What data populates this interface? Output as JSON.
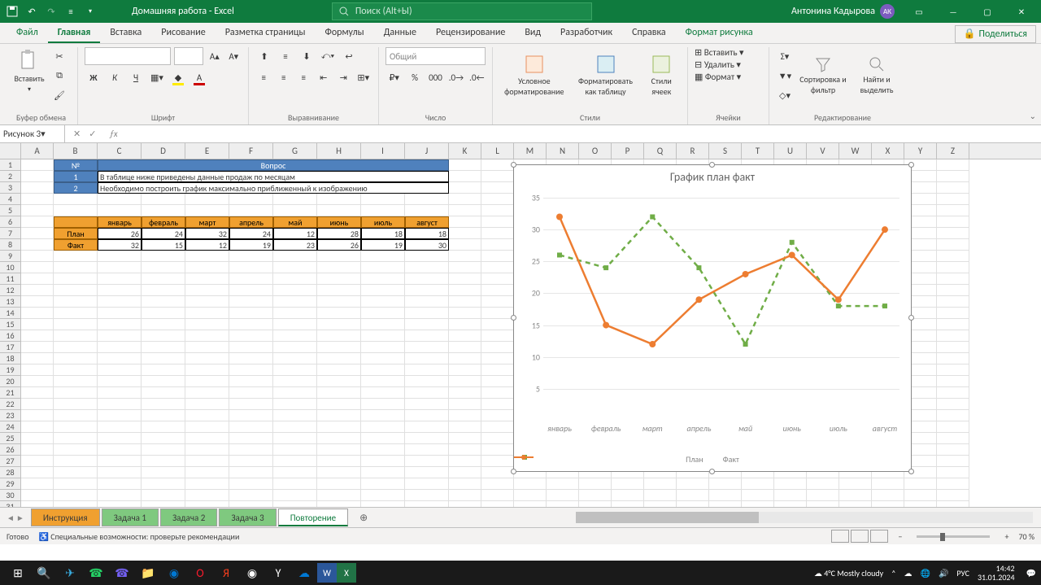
{
  "titlebar": {
    "title": "Домашняя работа  -  Excel",
    "search_placeholder": "Поиск (Alt+Ы)",
    "user": "Антонина Кадырова",
    "initials": "АК"
  },
  "tabs": {
    "file": "Файл",
    "home": "Главная",
    "insert": "Вставка",
    "draw": "Рисование",
    "layout": "Разметка страницы",
    "formulas": "Формулы",
    "data": "Данные",
    "review": "Рецензирование",
    "view": "Вид",
    "developer": "Разработчик",
    "help": "Справка",
    "pictureformat": "Формат рисунка",
    "share": "Поделиться"
  },
  "ribbon": {
    "clipboard": {
      "paste": "Вставить",
      "label": "Буфер обмена"
    },
    "font": {
      "label": "Шрифт"
    },
    "align": {
      "label": "Выравнивание"
    },
    "number": {
      "format": "Общий",
      "label": "Число"
    },
    "styles": {
      "cond": "Условное форматирование",
      "table": "Форматировать как таблицу",
      "cell": "Стили ячеек",
      "label": "Стили"
    },
    "cells": {
      "insert": "Вставить",
      "delete": "Удалить",
      "format": "Формат",
      "label": "Ячейки"
    },
    "editing": {
      "sort": "Сортировка и фильтр",
      "find": "Найти и выделить",
      "label": "Редактирование"
    }
  },
  "namebox": "Рисунок 3",
  "sheet": {
    "hdr_num": "№",
    "hdr_q": "Вопрос",
    "n1": "1",
    "n2": "2",
    "q1": "В таблице ниже приведены  данные продаж по месяцам",
    "q2": "Необходимо построить график максимально приближенный к изображению",
    "months": [
      "январь",
      "февраль",
      "март",
      "апрель",
      "май",
      "июнь",
      "июль",
      "август"
    ],
    "plan_label": "План",
    "fact_label": "Факт",
    "plan": [
      "26",
      "24",
      "32",
      "24",
      "12",
      "28",
      "18",
      "18"
    ],
    "fact": [
      "32",
      "15",
      "12",
      "19",
      "23",
      "26",
      "19",
      "30"
    ]
  },
  "chart_data": {
    "type": "line",
    "title": "График план факт",
    "categories": [
      "январь",
      "февраль",
      "март",
      "апрель",
      "май",
      "июнь",
      "июль",
      "август"
    ],
    "series": [
      {
        "name": "План",
        "values": [
          26,
          24,
          32,
          24,
          12,
          28,
          18,
          18
        ],
        "style": "dashed",
        "color": "#70ad47"
      },
      {
        "name": "Факт",
        "values": [
          32,
          15,
          12,
          19,
          23,
          26,
          19,
          30
        ],
        "style": "solid",
        "color": "#ed7d31"
      }
    ],
    "ylim": [
      0,
      35
    ],
    "yticks": [
      5,
      10,
      15,
      20,
      25,
      30,
      35
    ]
  },
  "sheets": {
    "instr": "Инструкция",
    "t1": "Задача 1",
    "t2": "Задача 2",
    "t3": "Задача 3",
    "active": "Повторение"
  },
  "status": {
    "ready": "Готово",
    "acc": "Специальные возможности: проверьте рекомендации",
    "zoom": "70 %"
  },
  "taskbar": {
    "weather": "4°C  Mostly cloudy",
    "lang": "РУС",
    "time": "14:42",
    "date": "31.01.2024"
  }
}
